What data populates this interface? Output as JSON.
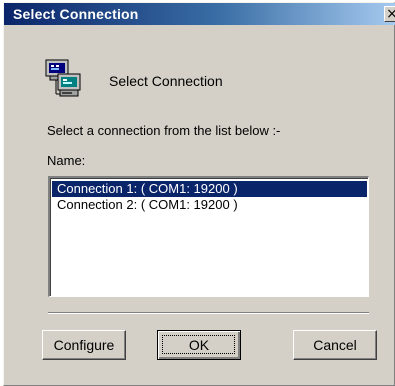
{
  "window": {
    "title": "Select Connection",
    "close_glyph": "×"
  },
  "header": {
    "icon": "network-computers-icon",
    "title": "Select Connection"
  },
  "instruction": "Select a connection from the list below :-",
  "list": {
    "label": "Name:",
    "items": [
      {
        "label": "Connection 1: ( COM1: 19200  )",
        "selected": true
      },
      {
        "label": "Connection 2: ( COM1: 19200  )",
        "selected": false
      }
    ]
  },
  "buttons": {
    "configure": "Configure",
    "ok": "OK",
    "cancel": "Cancel"
  },
  "colors": {
    "title_bar_start": "#0a246a",
    "title_bar_end": "#a6caf0",
    "dialog_face": "#d4d0c8",
    "selection": "#0a246a"
  }
}
